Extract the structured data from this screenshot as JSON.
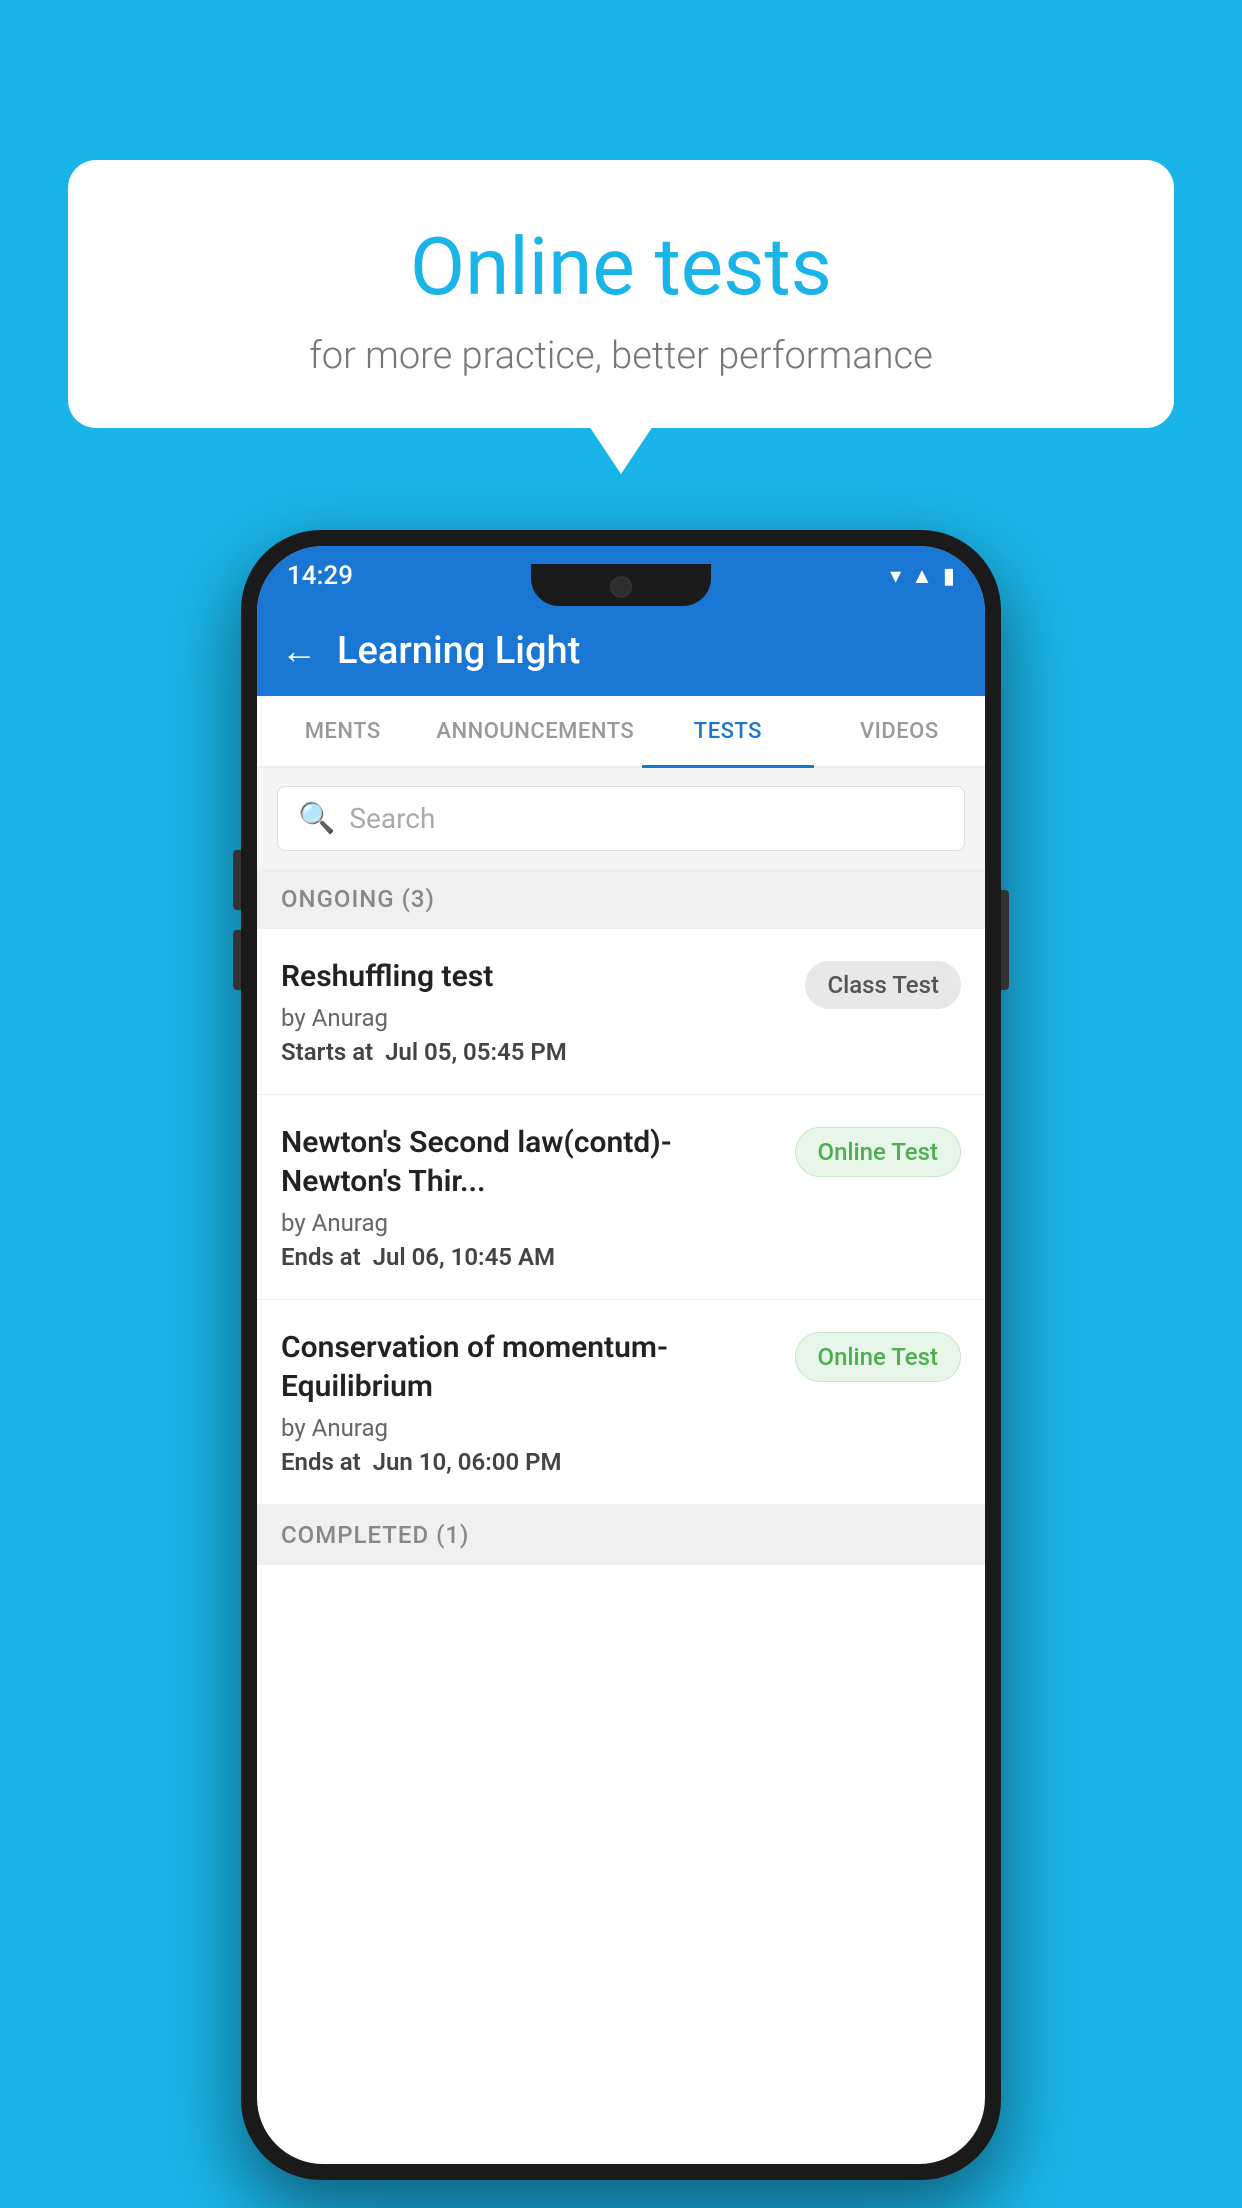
{
  "background": {
    "color": "#1ab5e8"
  },
  "speech_bubble": {
    "title": "Online tests",
    "subtitle": "for more practice, better performance"
  },
  "phone": {
    "status_bar": {
      "time": "14:29",
      "icons": [
        "wifi",
        "signal",
        "battery"
      ]
    },
    "header": {
      "back_label": "←",
      "title": "Learning Light"
    },
    "tabs": [
      {
        "label": "MENTS",
        "active": false
      },
      {
        "label": "ANNOUNCEMENTS",
        "active": false
      },
      {
        "label": "TESTS",
        "active": true
      },
      {
        "label": "VIDEOS",
        "active": false
      }
    ],
    "search": {
      "placeholder": "Search"
    },
    "ongoing_section": {
      "title": "ONGOING (3)"
    },
    "tests": [
      {
        "name": "Reshuffling test",
        "author": "by Anurag",
        "time_label": "Starts at",
        "time_value": "Jul 05, 05:45 PM",
        "badge": "Class Test",
        "badge_type": "class"
      },
      {
        "name": "Newton's Second law(contd)-Newton's Thir...",
        "author": "by Anurag",
        "time_label": "Ends at",
        "time_value": "Jul 06, 10:45 AM",
        "badge": "Online Test",
        "badge_type": "online"
      },
      {
        "name": "Conservation of momentum-Equilibrium",
        "author": "by Anurag",
        "time_label": "Ends at",
        "time_value": "Jun 10, 06:00 PM",
        "badge": "Online Test",
        "badge_type": "online"
      }
    ],
    "completed_section": {
      "title": "COMPLETED (1)"
    }
  }
}
